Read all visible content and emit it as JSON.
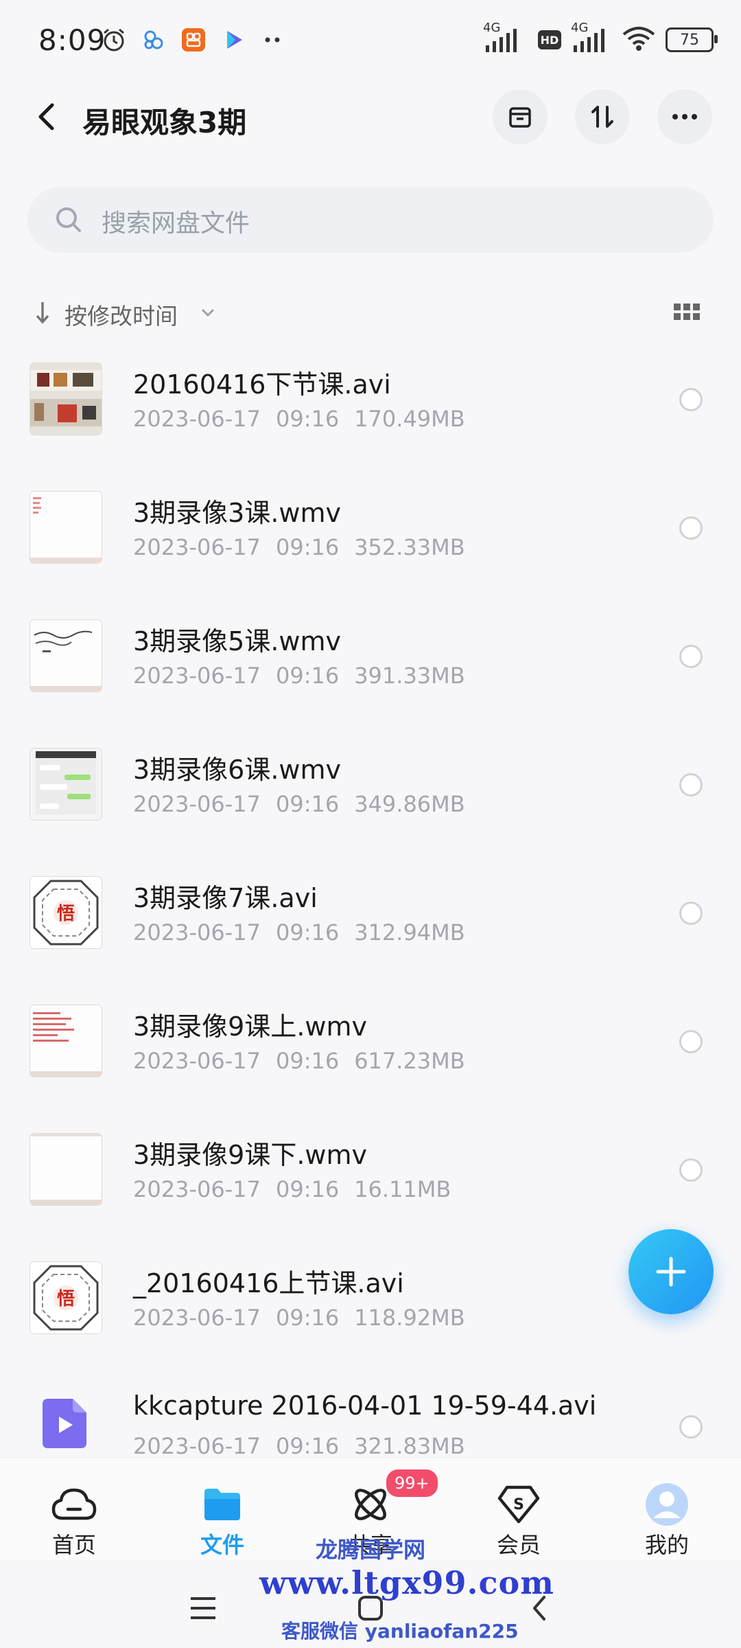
{
  "status_bar": {
    "time": "8:09",
    "network_1": "4G",
    "hd": "HD",
    "network_2": "4G",
    "battery": "75"
  },
  "header": {
    "title": "易眼观象3期"
  },
  "search": {
    "placeholder": "搜索网盘文件"
  },
  "sort": {
    "label": "按修改时间"
  },
  "files": [
    {
      "name": "20160416下节课.avi",
      "date": "2023-06-17",
      "time": "09:16",
      "size": "170.49MB"
    },
    {
      "name": "3期录像3课.wmv",
      "date": "2023-06-17",
      "time": "09:16",
      "size": "352.33MB"
    },
    {
      "name": "3期录像5课.wmv",
      "date": "2023-06-17",
      "time": "09:16",
      "size": "391.33MB"
    },
    {
      "name": "3期录像6课.wmv",
      "date": "2023-06-17",
      "time": "09:16",
      "size": "349.86MB"
    },
    {
      "name": "3期录像7课.avi",
      "date": "2023-06-17",
      "time": "09:16",
      "size": "312.94MB"
    },
    {
      "name": "3期录像9课上.wmv",
      "date": "2023-06-17",
      "time": "09:16",
      "size": "617.23MB"
    },
    {
      "name": "3期录像9课下.wmv",
      "date": "2023-06-17",
      "time": "09:16",
      "size": "16.11MB"
    },
    {
      "name": "_20160416上节课.avi",
      "date": "2023-06-17",
      "time": "09:16",
      "size": "118.92MB"
    },
    {
      "name": "kkcapture 2016-04-01 19-59-44.avi",
      "date": "2023-06-17",
      "time": "09:16",
      "size": "321.83MB"
    }
  ],
  "bottom_nav": {
    "items": [
      {
        "label": "首页",
        "icon": "cloud-icon"
      },
      {
        "label": "文件",
        "icon": "folder-icon"
      },
      {
        "label": "共享",
        "icon": "atom-icon",
        "badge": "99+"
      },
      {
        "label": "会员",
        "icon": "vip-icon"
      },
      {
        "label": "我的",
        "icon": "avatar-icon"
      }
    ],
    "active_index": 1
  },
  "watermark": {
    "line1": "龙腾国学网",
    "line2": "www.ltgx99.com",
    "line3": "客服微信 yanliaofan225"
  },
  "colors": {
    "accent": "#1e9cf0",
    "badge": "#f24d6b",
    "fab": "#2196f3"
  }
}
